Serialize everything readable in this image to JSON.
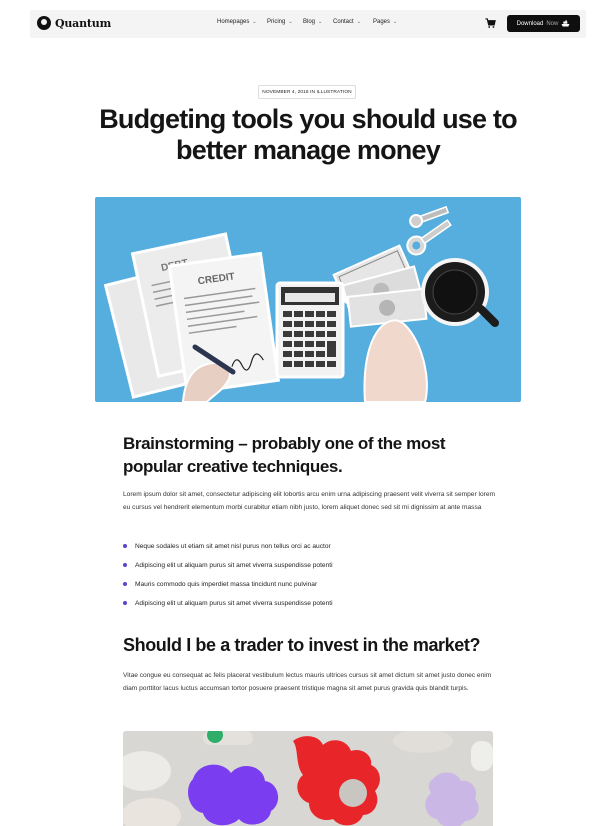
{
  "nav": {
    "brand": "Quantum",
    "menu": [
      {
        "label": "Homepages"
      },
      {
        "label": "Pricing"
      },
      {
        "label": "Blog"
      },
      {
        "label": "Contact"
      },
      {
        "label": "Pages"
      }
    ],
    "cta_primary": "Download",
    "cta_secondary": "Now"
  },
  "post": {
    "meta": "NOVEMBER 4, 2016 IN ILLUSTRATION",
    "title": "Budgeting tools you should use to better manage money",
    "hero_labels": {
      "doc_back": "DEBT",
      "doc_front": "CREDIT"
    },
    "section1": {
      "heading": "Brainstorming – probably one of the most popular creative techniques.",
      "body": "Lorem ipsum dolor sit amet, consectetur adipiscing elit lobortis arcu enim urna adipiscing praesent velit viverra sit semper lorem eu cursus vel hendrerit elementum morbi curabitur etiam nibh justo, lorem aliquet donec sed sit mi dignissim at ante massa",
      "bullets": [
        "Neque sodales ut etiam sit amet nisl purus non tellus orci ac auctor",
        "Adipiscing elit ut aliquam purus sit amet viverra suspendisse potenti",
        "Mauris commodo quis imperdiet massa tincidunt nunc pulvinar",
        "Adipiscing elit ut aliquam purus sit amet viverra suspendisse potenti"
      ]
    },
    "section2": {
      "heading": "Should I be a trader to invest in the market?",
      "body": "Vitae congue eu consequat ac felis placerat vestibulum lectus mauris ultrices cursus sit amet dictum sit amet justo donec enim diam porttitor lacus luctus accumsan tortor posuere praesent tristique magna sit amet purus gravida quis blandit turpis."
    }
  },
  "colors": {
    "nav_bg": "#f4f4f4",
    "cta_bg": "#0f0f0f",
    "hero_bg": "#55aede",
    "bullet": "#5a45c7"
  },
  "icons": [
    "logo-mark-icon",
    "chevron-down-icon",
    "cart-icon",
    "ship-icon"
  ]
}
